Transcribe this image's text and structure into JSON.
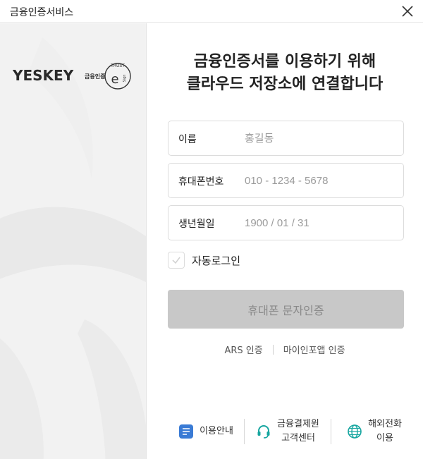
{
  "window": {
    "title": "금융인증서비스"
  },
  "logo": {
    "brand": "YESKEY",
    "brand_sub": "금융인증",
    "badge_top": "TRUST",
    "badge_e": "e",
    "badge_sign": "Sign"
  },
  "heading": {
    "line1": "금융인증서를 이용하기 위해",
    "line2": "클라우드 저장소에 연결합니다"
  },
  "form": {
    "name": {
      "label": "이름",
      "placeholder": "홍길동"
    },
    "phone": {
      "label": "휴대폰번호",
      "placeholder": "010 - 1234 - 5678"
    },
    "birth": {
      "label": "생년월일",
      "placeholder": "1900 / 01 / 31"
    },
    "auto_login": {
      "label": "자동로그인",
      "checked": false
    }
  },
  "submit_button": {
    "label": "휴대폰 문자인증"
  },
  "alt_links": {
    "ars": "ARS 인증",
    "mypin": "마이인포앱 인증"
  },
  "footer": {
    "guide": {
      "label": "이용안내",
      "icon": "document-icon"
    },
    "support": {
      "line1": "금융결제원",
      "line2": "고객센터",
      "icon": "headset-icon"
    },
    "overseas": {
      "line1": "해외전화",
      "line2": "이용",
      "icon": "globe-icon"
    }
  },
  "colors": {
    "accent_blue": "#3a7bd5",
    "teal": "#17a6a0",
    "button_disabled": "#c8c8c8"
  }
}
